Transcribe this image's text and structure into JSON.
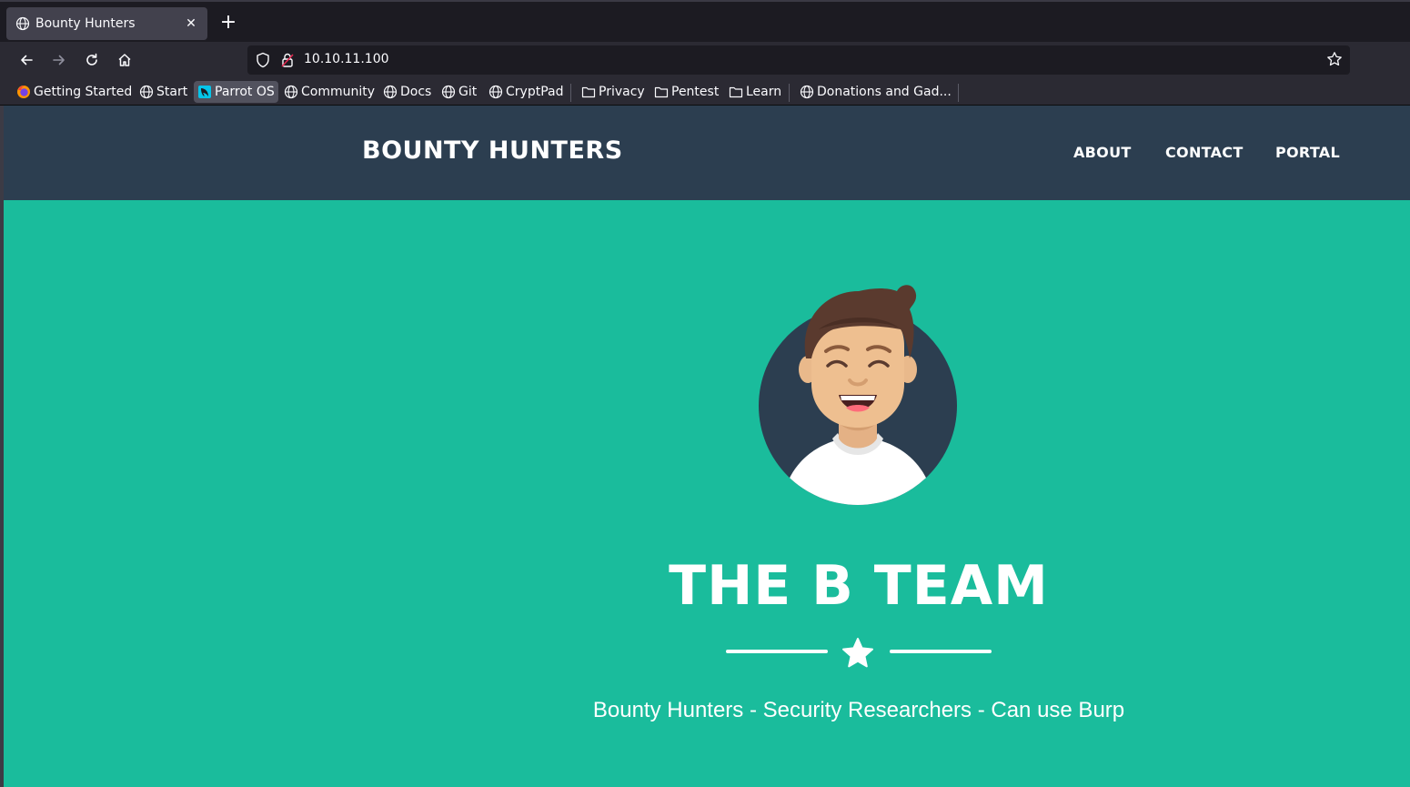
{
  "browser": {
    "tab": {
      "title": "Bounty Hunters",
      "icon": "globe-icon"
    },
    "new_tab_label": "+",
    "url": "10.10.11.100",
    "bookmarks": [
      {
        "label": "Getting Started",
        "icon": "firefox-icon"
      },
      {
        "label": "Start",
        "icon": "globe-icon"
      },
      {
        "label": "Parrot OS",
        "icon": "parrot-icon"
      },
      {
        "label": "Community",
        "icon": "globe-icon"
      },
      {
        "label": "Docs",
        "icon": "globe-icon"
      },
      {
        "label": "Git",
        "icon": "globe-icon"
      },
      {
        "label": "CryptPad",
        "icon": "globe-icon"
      },
      {
        "label": "Privacy",
        "icon": "folder-icon"
      },
      {
        "label": "Pentest",
        "icon": "folder-icon"
      },
      {
        "label": "Learn",
        "icon": "folder-icon"
      },
      {
        "label": "Donations and Gad...",
        "icon": "globe-icon"
      }
    ]
  },
  "site": {
    "brand": "BOUNTY HUNTERS",
    "nav": [
      "ABOUT",
      "CONTACT",
      "PORTAL"
    ],
    "hero": {
      "title": "THE B TEAM",
      "subtitle": "Bounty Hunters - Security Researchers - Can use Burp"
    },
    "colors": {
      "header_bg": "#2c3e50",
      "hero_bg": "#1abc9c",
      "text": "#ffffff"
    }
  }
}
